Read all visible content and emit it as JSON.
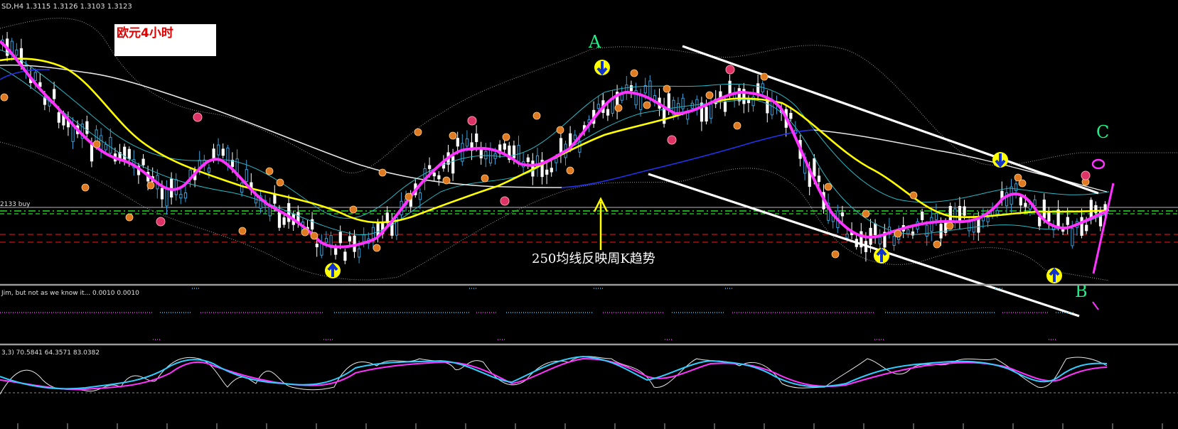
{
  "main_panel": {
    "header": "SD,H4  1.3115  1.3126  1.3103  1.3123",
    "title_box": "欧元4小时",
    "buy_label": "2133 buy",
    "annotation": "250均线反映周K趋势",
    "letters": {
      "a": "A",
      "b": "B",
      "c": "C"
    }
  },
  "indicator_panel": {
    "header": "Jim, but not as we know it...  0.0010 0.0010"
  },
  "stoch_panel": {
    "header": "3,3) 70.5841 64.3571 83.0382"
  },
  "colors": {
    "background": "#000000",
    "bull_candle": "#3aa0d8",
    "bear_candle": "#ffffff",
    "ma_magenta": "#ff33ff",
    "ma_yellow": "#ffff00",
    "ma_white": "#e8e8e8",
    "ma_blue": "#2233ee",
    "envelope": "#2ab7c4",
    "grid_line": "#c0c0c0",
    "dash_green": "#22dd22",
    "dash_red": "#cc1111",
    "stoch_signal": "#ff33ff",
    "stoch_main": "#33ccff",
    "annotation_arrow": "#ffff00",
    "letter": "#22ee88",
    "title_text": "#dd0000"
  },
  "chart_data": {
    "type": "candlestick",
    "symbol_timeframe": "H4",
    "ohlc": {
      "open": 1.3115,
      "high": 1.3126,
      "low": 1.3103,
      "close": 1.3123
    },
    "pattern_markers": [
      {
        "label": "A",
        "type": "top"
      },
      {
        "label": "B",
        "type": "bottom"
      },
      {
        "label": "C",
        "type": "projection"
      }
    ],
    "indicators": [
      {
        "name": "Jim, but not as we know it...",
        "values": [
          0.001,
          0.001
        ]
      },
      {
        "name": "stochastic",
        "values": [
          70.5841,
          64.3571,
          83.0382
        ]
      }
    ]
  }
}
